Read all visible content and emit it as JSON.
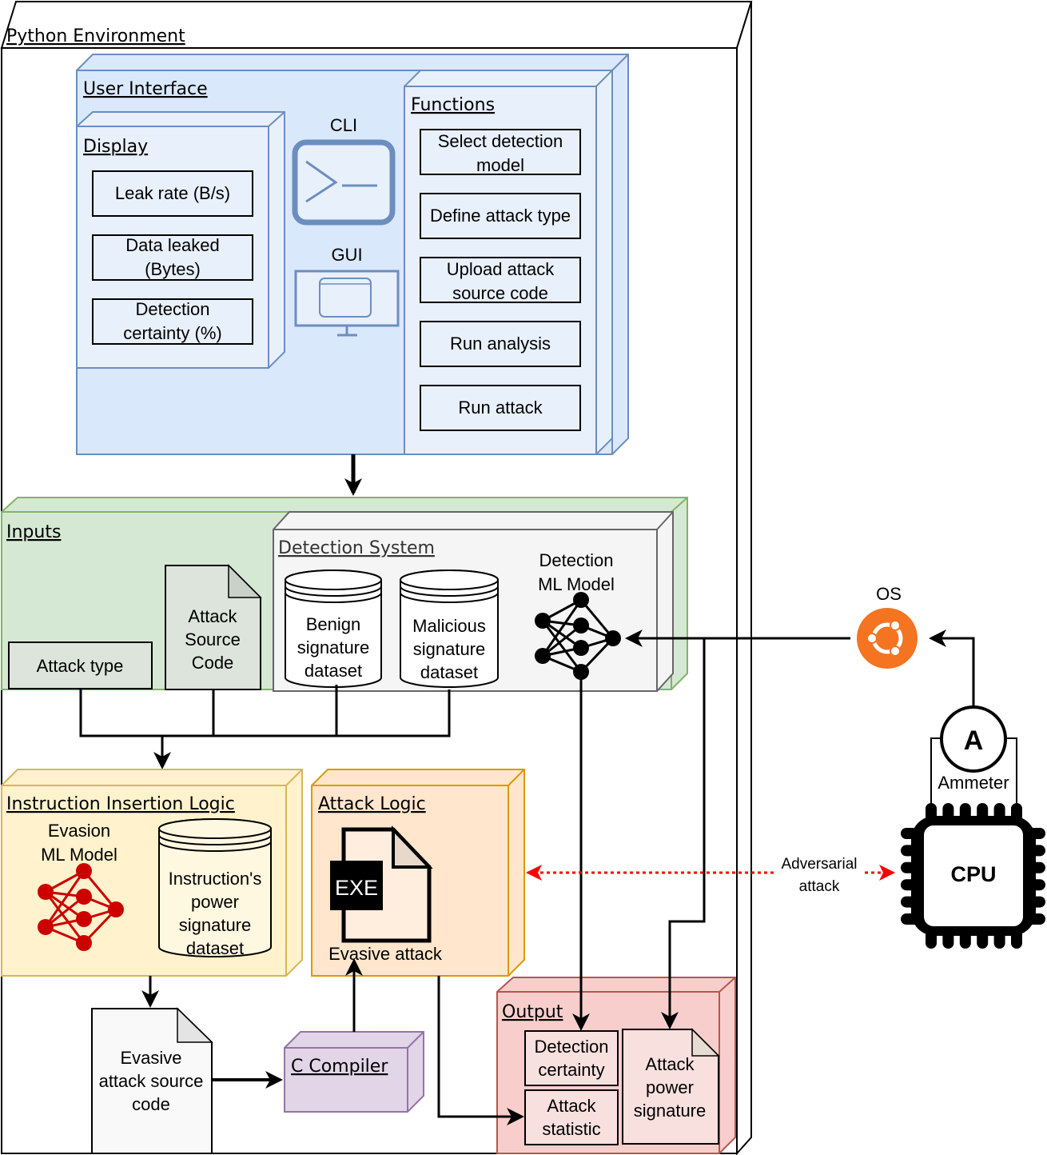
{
  "python_env": {
    "title": "Python Environment"
  },
  "user_interface": {
    "title": "User Interface",
    "display": {
      "title": "Display",
      "items": [
        "Leak rate (B/s)",
        "Data leaked|(Bytes)",
        "Detection|certainty (%)"
      ]
    },
    "cli_label": "CLI",
    "gui_label": "GUI",
    "functions": {
      "title": "Functions",
      "items": [
        "Select detection|model",
        "Define attack type",
        "Upload attack|source code",
        "Run analysis",
        "Run attack"
      ]
    }
  },
  "inputs": {
    "title": "Inputs",
    "attack_type": "Attack type",
    "attack_source_code": "Attack|Source|Code"
  },
  "detection_system": {
    "title": "Detection System",
    "benign_dataset": "Benign|signature|dataset",
    "malicious_dataset": "Malicious|signature|dataset",
    "model_label": "Detection|ML Model"
  },
  "instruction_insertion": {
    "title": "Instruction Insertion Logic",
    "model_label": "Evasion|ML Model",
    "dataset": "Instruction's|power|signature|dataset"
  },
  "attack_logic": {
    "title": "Attack Logic",
    "exe_badge": "EXE",
    "file_label": "Evasive attack"
  },
  "evasive_source": {
    "label": "Evasive|attack source|code"
  },
  "compiler": {
    "title": "C Compiler"
  },
  "output": {
    "title": "Output",
    "detection_certainty": "Detection|certainty",
    "attack_statistic": "Attack|statistic",
    "attack_power_signature": "Attack|power|signature"
  },
  "os": {
    "label": "OS",
    "icon": "ubuntu-icon",
    "color": "#F47421"
  },
  "ammeter": {
    "symbol": "A",
    "label": "Ammeter"
  },
  "cpu": {
    "label": "CPU"
  },
  "adversarial": {
    "label": "Adversarial|attack",
    "color": "#FF0000"
  },
  "colors": {
    "ui_fill": "#DAE8FC",
    "ui_stroke": "#6C8EBF",
    "inputs_fill": "#D5E8D4",
    "inputs_stroke": "#82B366",
    "detect_fill": "#F5F5F5",
    "detect_stroke": "#666666",
    "insert_fill": "#FFF2CC",
    "insert_stroke": "#D6B656",
    "attack_fill": "#FFE6CC",
    "attack_stroke": "#D79B00",
    "output_fill": "#F8CECC",
    "output_stroke": "#B85450",
    "compiler_fill": "#E1D5E7",
    "compiler_stroke": "#9673A6",
    "ml_red": "#CC0000"
  }
}
